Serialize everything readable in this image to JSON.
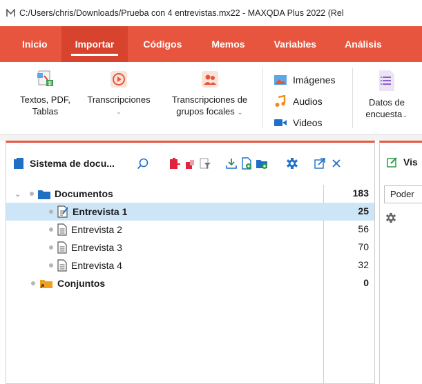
{
  "window": {
    "title": "C:/Users/chris/Downloads/Prueba con 4 entrevistas.mx22 - MAXQDA Plus 2022 (Rel",
    "app_icon": "maxqda-logo-icon"
  },
  "ribbon_tabs": [
    {
      "label": "Inicio",
      "active": false
    },
    {
      "label": "Importar",
      "active": true
    },
    {
      "label": "Códigos",
      "active": false
    },
    {
      "label": "Memos",
      "active": false
    },
    {
      "label": "Variables",
      "active": false
    },
    {
      "label": "Análisis",
      "active": false
    }
  ],
  "ribbon": {
    "textos": {
      "line1": "Textos, PDF,",
      "line2": "Tablas",
      "icon": "texts-pdf-tables-icon"
    },
    "transcripciones": {
      "line1": "Transcripciones",
      "icon": "transcription-play-icon"
    },
    "grupos": {
      "line1": "Transcripciones de",
      "line2": "grupos focales",
      "icon": "focus-group-icon"
    },
    "imagenes": {
      "label": "Imágenes",
      "icon": "image-icon"
    },
    "audios": {
      "label": "Audios",
      "icon": "audio-icon"
    },
    "videos": {
      "label": "Videos",
      "icon": "video-icon"
    },
    "datos": {
      "line1": "Datos de",
      "line2": "encuesta",
      "icon": "survey-data-icon"
    }
  },
  "document_system": {
    "title": "Sistema de docu...",
    "rows": [
      {
        "label": "Documentos",
        "count": "183"
      },
      {
        "label": "Entrevista 1",
        "count": "25"
      },
      {
        "label": "Entrevista 2",
        "count": "56"
      },
      {
        "label": "Entrevista 3",
        "count": "70"
      },
      {
        "label": "Entrevista 4",
        "count": "32"
      },
      {
        "label": "Conjuntos",
        "count": "0"
      }
    ]
  },
  "right_panel": {
    "title": "Vis",
    "field": "Poder"
  },
  "colors": {
    "accent": "#e8553e",
    "selected_row": "#cde6f7",
    "folder_blue": "#1f6fc5"
  }
}
